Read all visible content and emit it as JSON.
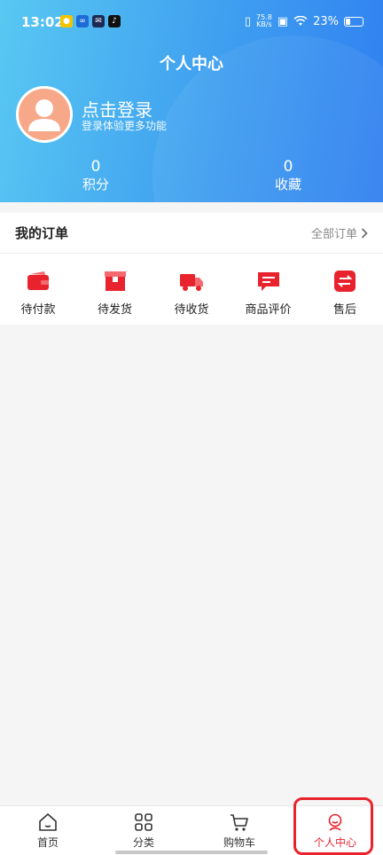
{
  "status_bar": {
    "time": "13:02",
    "net_speed_value": "75.8",
    "net_speed_unit": "KB/s",
    "battery": "23%"
  },
  "header": {
    "title": "个人中心",
    "login_title": "点击登录",
    "login_sub": "登录体验更多功能",
    "stats": [
      {
        "value": "0",
        "label": "积分"
      },
      {
        "value": "0",
        "label": "收藏"
      }
    ]
  },
  "orders": {
    "title": "我的订单",
    "all_label": "全部订单",
    "items": [
      {
        "label": "待付款",
        "icon": "wallet-icon"
      },
      {
        "label": "待发货",
        "icon": "package-icon"
      },
      {
        "label": "待收货",
        "icon": "truck-icon"
      },
      {
        "label": "商品评价",
        "icon": "comment-icon"
      },
      {
        "label": "售后",
        "icon": "exchange-icon"
      }
    ]
  },
  "bottom_nav": {
    "items": [
      {
        "label": "首页",
        "icon": "home-icon"
      },
      {
        "label": "分类",
        "icon": "grid-icon"
      },
      {
        "label": "购物车",
        "icon": "cart-icon"
      },
      {
        "label": "个人中心",
        "icon": "profile-icon",
        "active": true
      }
    ]
  },
  "colors": {
    "accent_red": "#e8232d",
    "header_gradient_start": "#58c8f2",
    "header_gradient_end": "#2f7ff0",
    "avatar_bg": "#f6a888"
  }
}
